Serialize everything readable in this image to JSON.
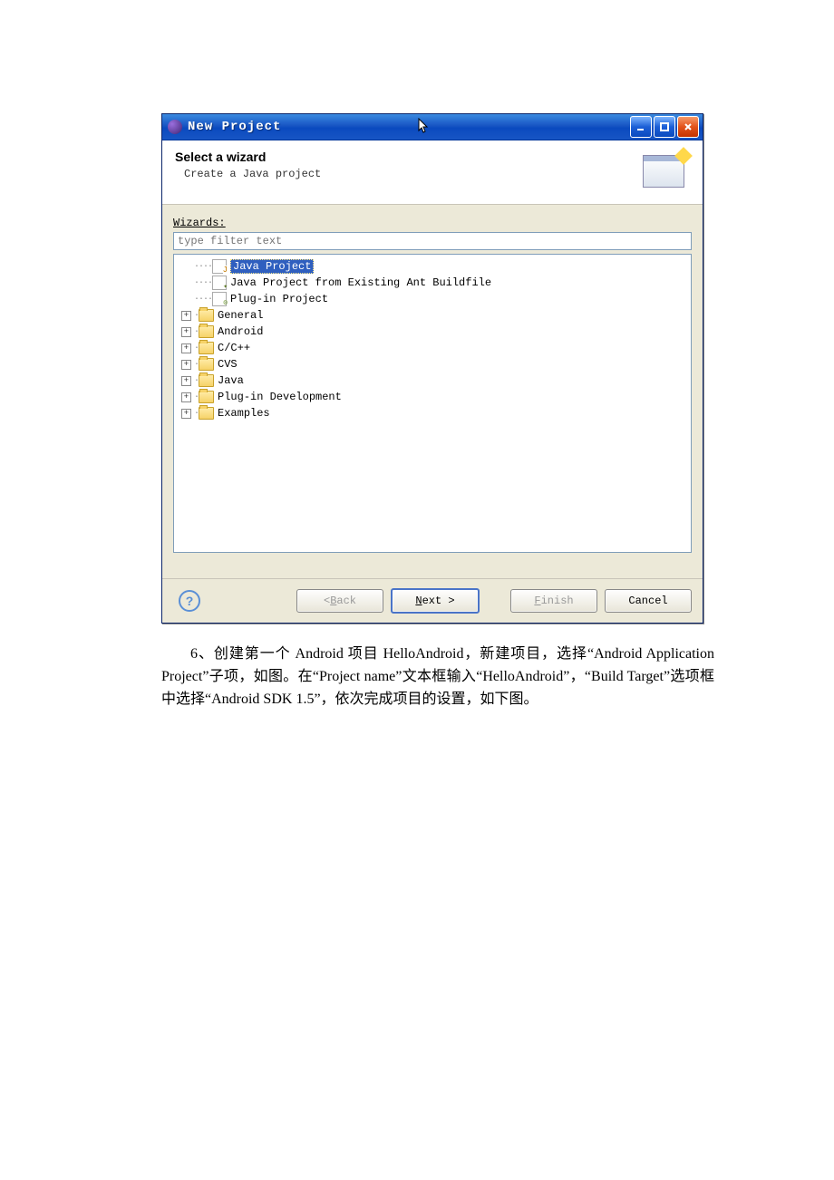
{
  "window": {
    "title": "New Project"
  },
  "banner": {
    "title": "Select a wizard",
    "subtitle": "Create a Java project"
  },
  "wizards_label": "Wizards:",
  "filter_placeholder": "type filter text",
  "tree": {
    "items": [
      {
        "label": "Java Project"
      },
      {
        "label": "Java Project from Existing Ant Buildfile"
      },
      {
        "label": "Plug-in Project"
      }
    ],
    "folders": [
      {
        "label": "General"
      },
      {
        "label": "Android"
      },
      {
        "label": "C/C++"
      },
      {
        "label": "CVS"
      },
      {
        "label": "Java"
      },
      {
        "label": "Plug-in Development"
      },
      {
        "label": "Examples"
      }
    ]
  },
  "buttons": {
    "back": "< Back",
    "next": "Next >",
    "finish": "Finish",
    "cancel": "Cancel"
  },
  "caption": {
    "line1": "6、创建第一个 Android 项目 HelloAndroid，新建项目，选择“Android Application Project”子项，如图。在“Project name”文本框输入“HelloAndroid”，“Build Target”选项框中选择“Android SDK 1.5”，依次完成项目的设置，如下图。"
  }
}
